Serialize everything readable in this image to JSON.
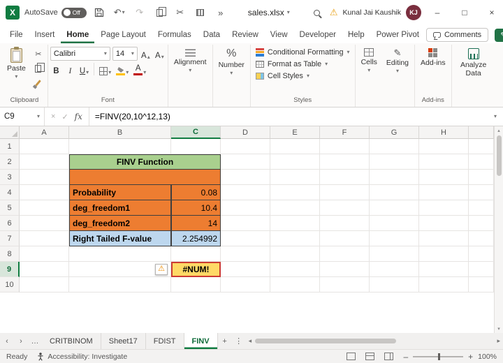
{
  "colors": {
    "accent_green": "#217346",
    "table_header_green": "#A9D08E",
    "table_input_orange": "#ED7D31",
    "table_result_blue": "#BDD7EE",
    "error_cell_yellow": "#FFD966",
    "annotation_red": "#CC3B33",
    "avatar_maroon": "#7A2E3E"
  },
  "icons": {
    "dropdown": "▾",
    "tri_up": "▴",
    "tri_down": "▾",
    "tri_left": "◂",
    "tri_right": "▸",
    "nav_left": "‹",
    "nav_right": "›",
    "ellipsis": "…",
    "kebab": "⋮",
    "plus": "+",
    "overflow": "»",
    "undo": "↶",
    "redo": "↷",
    "scissors": "✂",
    "warning": "⚠",
    "minimize": "–",
    "maximize": "□",
    "close": "×",
    "cancel": "×",
    "check": "✓",
    "pencil": "✎",
    "percent": "%"
  },
  "titlebar": {
    "autosave_label": "AutoSave",
    "autosave_state": "Off",
    "filename": "sales.xlsx",
    "user_name": "Kunal Jai Kaushik",
    "user_initials": "KJ"
  },
  "ribbon_tabs": {
    "items": [
      "File",
      "Insert",
      "Home",
      "Page Layout",
      "Formulas",
      "Data",
      "Review",
      "View",
      "Developer",
      "Help",
      "Power Pivot"
    ],
    "active": "Home",
    "comments_label": "Comments"
  },
  "ribbon": {
    "paste_label": "Paste",
    "clipboard_group": "Clipboard",
    "font_name": "Calibri",
    "font_size": "14",
    "bold": "B",
    "italic": "I",
    "underline": "U",
    "letter_a": "A",
    "font_group": "Font",
    "alignment_label": "Alignment",
    "number_label": "Number",
    "conditional_formatting": "Conditional Formatting",
    "format_as_table": "Format as Table",
    "cell_styles": "Cell Styles",
    "styles_group": "Styles",
    "cells_label": "Cells",
    "editing_label": "Editing",
    "addins_label": "Add-ins",
    "addins_group": "Add-ins",
    "analyze_data_label": "Analyze Data"
  },
  "formula_bar": {
    "name_box": "C9",
    "fx": "fx",
    "formula": "=FINV(20,10^12,13)"
  },
  "grid": {
    "columns": [
      "A",
      "B",
      "C",
      "D",
      "E",
      "F",
      "G",
      "H"
    ],
    "rows": [
      "1",
      "2",
      "3",
      "4",
      "5",
      "6",
      "7",
      "8",
      "9",
      "10"
    ],
    "selected_cell": "C9",
    "selected_column": "C",
    "selected_row": "9"
  },
  "worksheet": {
    "table_title": "FINV Function",
    "rows": [
      {
        "label": "Probability",
        "value": "0.08"
      },
      {
        "label": "deg_freedom1",
        "value": "10.4"
      },
      {
        "label": "deg_freedom2",
        "value": "14"
      },
      {
        "label": "Right Tailed F-value",
        "value": "2.254992"
      }
    ],
    "error_value": "#NUM!"
  },
  "sheet_tabs": {
    "items": [
      "CRITBINOM",
      "Sheet17",
      "FDIST",
      "FINV"
    ],
    "active": "FINV"
  },
  "status_bar": {
    "mode": "Ready",
    "accessibility": "Accessibility: Investigate",
    "zoom": "100%"
  }
}
